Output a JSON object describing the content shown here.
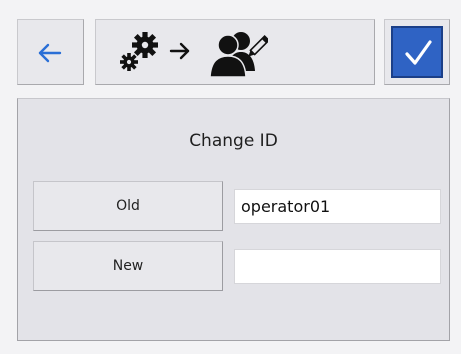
{
  "toolbar": {
    "back_icon": "arrow-left-icon",
    "title_icons": [
      "gears-icon",
      "arrow-right-icon",
      "user-edit-icon"
    ],
    "confirm_icon": "checkmark-icon",
    "colors": {
      "back_arrow": "#2a6fd6",
      "confirm_bg": "#2f63c4",
      "confirm_check": "#ffffff"
    }
  },
  "panel": {
    "title": "Change ID",
    "fields": [
      {
        "label": "Old",
        "value": "operator01"
      },
      {
        "label": "New",
        "value": ""
      }
    ]
  }
}
